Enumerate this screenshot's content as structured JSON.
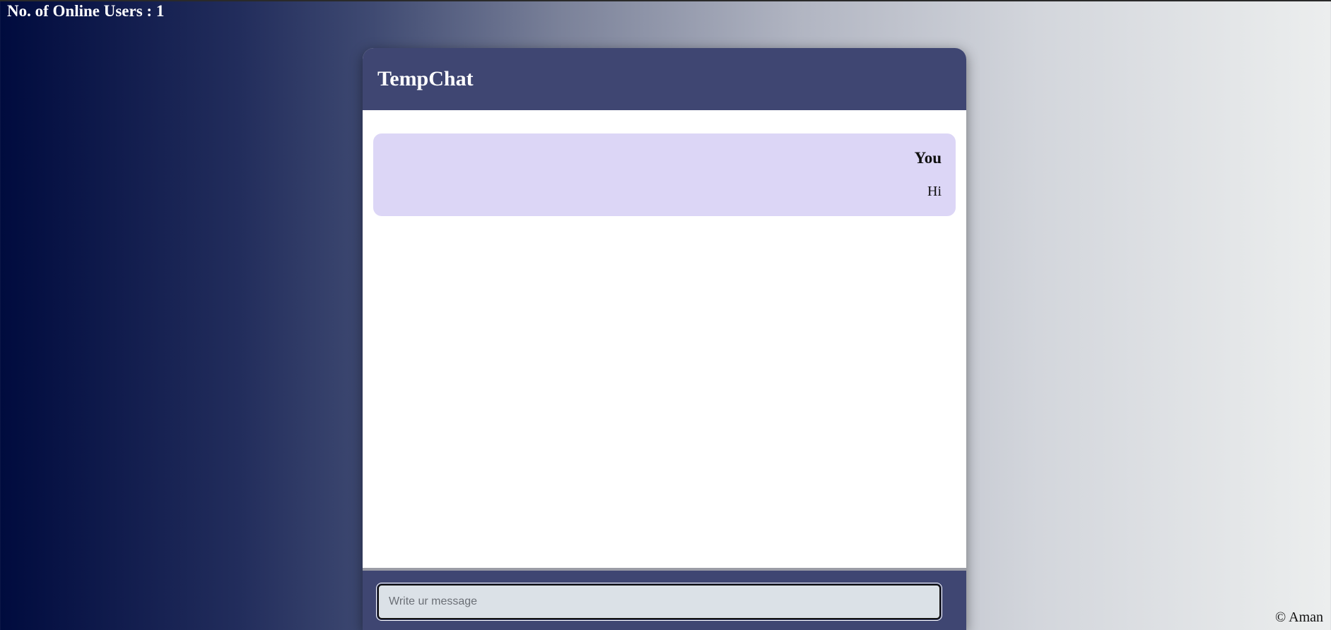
{
  "status": {
    "online_users_label": "No. of Online Users : 1"
  },
  "chat": {
    "title": "TempChat",
    "messages": [
      {
        "sender": "You",
        "text": "Hi"
      }
    ],
    "input": {
      "value": "",
      "placeholder": "Write ur message"
    }
  },
  "footer": {
    "copyright": "© Aman"
  },
  "colors": {
    "header_bg": "#3f4672",
    "message_bubble_bg": "#dcd6f6",
    "input_bg": "#dbe1e7",
    "text_primary": "#111111",
    "text_light": "#ffffff"
  }
}
